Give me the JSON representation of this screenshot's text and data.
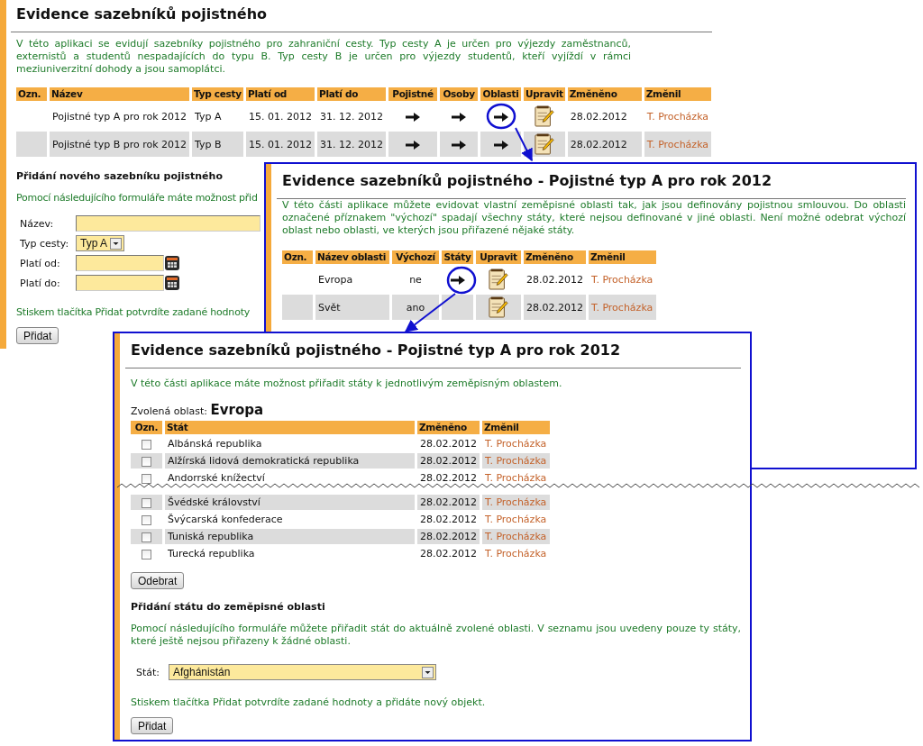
{
  "page": {
    "title": "Evidence sazebníků pojistného",
    "intro": "V této aplikaci se evidují sazebníky pojistného pro zahraniční cesty. Typ cesty A je určen pro výjezdy zaměstnanců, externistů a studentů nespadajících do typu B. Typ cesty B je určen pro výjezdy studentů, kteří vyjíždí v rámci meziuniverzitní dohody a jsou samoplátci.",
    "table": {
      "columns": [
        "Ozn.",
        "Název",
        "Typ cesty",
        "Platí od",
        "Platí do",
        "Pojistné",
        "Osoby",
        "Oblasti",
        "Upravit",
        "Změněno",
        "Změnil"
      ],
      "rows": [
        {
          "name": "Pojistné typ A pro rok 2012",
          "type": "Typ A",
          "from": "15. 01. 2012",
          "to": "31. 12. 2012",
          "changed": "28.02.2012",
          "changed_by": "T. Procházka"
        },
        {
          "name": "Pojistné typ B pro rok 2012",
          "type": "Typ B",
          "from": "15. 01. 2012",
          "to": "31. 12. 2012",
          "changed": "28.02.2012",
          "changed_by": "T. Procházka"
        }
      ]
    },
    "add_form": {
      "heading": "Přidání nového sazebníku pojistného",
      "hint": "Pomocí následujícího formuláře máte možnost přid",
      "fields": [
        {
          "label": "Název:",
          "kind": "text"
        },
        {
          "label": "Typ cesty:",
          "kind": "select",
          "value": "Typ A"
        },
        {
          "label": "Platí od:",
          "kind": "date"
        },
        {
          "label": "Platí do:",
          "kind": "date"
        }
      ],
      "confirm_hint": "Stiskem tlačítka Přidat potvrdíte zadané hodnoty",
      "button": "Přidat"
    }
  },
  "areas_panel": {
    "title": "Evidence sazebníků pojistného - Pojistné typ A pro rok 2012",
    "intro": "V této části aplikace můžete evidovat vlastní zeměpisné oblasti tak, jak jsou definovány pojistnou smlouvou. Do oblasti označené příznakem \"výchozí\" spadají všechny státy, které nejsou definované v jiné oblasti. Není možné odebrat výchozí oblast nebo oblasti, ve kterých jsou přiřazené nějaké státy.",
    "table": {
      "columns": [
        "Ozn.",
        "Název oblasti",
        "Výchozí",
        "Státy",
        "Upravit",
        "Změněno",
        "Změnil"
      ],
      "rows": [
        {
          "name": "Evropa",
          "default": "ne",
          "has_states": true,
          "changed": "28.02.2012",
          "changed_by": "T. Procházka"
        },
        {
          "name": "Svět",
          "default": "ano",
          "has_states": false,
          "changed": "28.02.2012",
          "changed_by": "T. Procházka"
        }
      ]
    }
  },
  "states_panel": {
    "title": "Evidence sazebníků pojistného - Pojistné typ A pro rok 2012",
    "intro": "V této části aplikace máte možnost přiřadit státy k jednotlivým zeměpisným oblastem.",
    "selected_area_label": "Zvolená oblast:",
    "selected_area": "Evropa",
    "table": {
      "columns": [
        "Ozn.",
        "Stát",
        "Změněno",
        "Změnil"
      ],
      "rows": [
        {
          "checked": false,
          "name": "Albánská republika",
          "changed": "28.02.2012",
          "changed_by": "T. Procházka"
        },
        {
          "checked": false,
          "name": "Alžírská lidová demokratická republika",
          "changed": "28.02.2012",
          "changed_by": "T. Procházka"
        },
        {
          "checked": false,
          "name": "Andorrské knížectví",
          "changed": "28.02.2012",
          "changed_by": "T. Procházka"
        }
      ],
      "rows_after_break": [
        {
          "checked": false,
          "name": "Švédské království",
          "changed": "28.02.2012",
          "changed_by": "T. Procházka"
        },
        {
          "checked": false,
          "name": "Švýcarská konfederace",
          "changed": "28.02.2012",
          "changed_by": "T. Procházka"
        },
        {
          "checked": false,
          "name": "Tuniská republika",
          "changed": "28.02.2012",
          "changed_by": "T. Procházka"
        },
        {
          "checked": false,
          "name": "Turecká republika",
          "changed": "28.02.2012",
          "changed_by": "T. Procházka"
        }
      ]
    },
    "remove_button": "Odebrat",
    "add_heading": "Přidání státu do zeměpisné oblasti",
    "add_hint": "Pomocí následujícího formuláře můžete přiřadit stát do aktuálně zvolené oblasti. V seznamu jsou uvedeny pouze ty státy, které ještě nejsou přiřazeny k žádné oblasti.",
    "state_field": {
      "label": "Stát:",
      "value": "Afghánistán"
    },
    "confirm_hint": "Stiskem tlačítka Přidat potvrdíte zadané hodnoty a přidáte nový objekt.",
    "add_button": "Přidat"
  }
}
